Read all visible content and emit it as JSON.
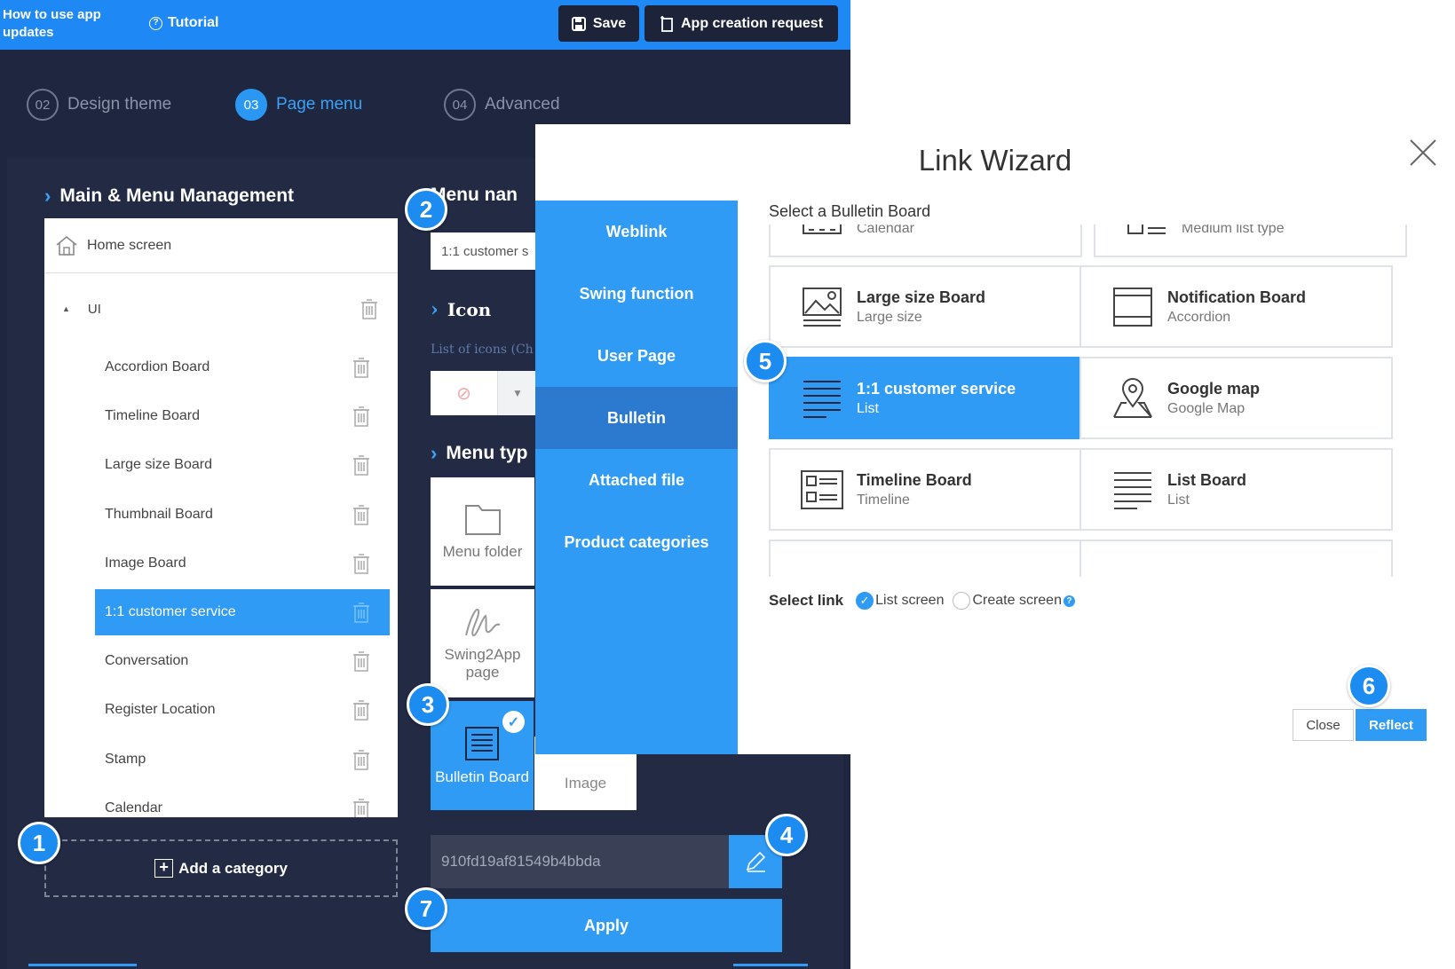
{
  "topbar": {
    "how_to": "How to use app updates",
    "tutorial": "Tutorial",
    "save": "Save",
    "app_request": "App creation request"
  },
  "steps": [
    {
      "num": "02",
      "label": "Design theme",
      "active": false
    },
    {
      "num": "03",
      "label": "Page menu",
      "active": true
    },
    {
      "num": "04",
      "label": "Advanced",
      "active": false
    }
  ],
  "main_menu": {
    "title": "Main & Menu Management",
    "home": "Home screen",
    "group": "UI",
    "items": [
      "Accordion Board",
      "Timeline Board",
      "Large size Board",
      "Thumbnail Board",
      "Image Board",
      "1:1 customer service",
      "Conversation",
      "Register Location",
      "Stamp",
      "Calendar"
    ],
    "selected_index": 5,
    "add_category": "Add a category"
  },
  "menu_name": {
    "title": "Menu nan",
    "value": "1:1 customer s"
  },
  "icon_section": {
    "title": "Icon",
    "list_label": "List of icons (Ch"
  },
  "menu_type": {
    "title": "Menu typ",
    "folder": "Menu folder",
    "swing": "Swing2App page",
    "bulletin": "Bulletin Board",
    "image": "Image"
  },
  "link_field": {
    "value": "910fd19af81549b4bbda",
    "apply": "Apply"
  },
  "wizard": {
    "title": "Link Wizard",
    "side_items": [
      "Weblink",
      "Swing function",
      "User Page",
      "Bulletin",
      "Attached file",
      "Product categories"
    ],
    "side_active_index": 3,
    "board_label": "Select a Bulletin Board",
    "partial_top": [
      "Calendar",
      "Medium list type"
    ],
    "boards": [
      {
        "title": "Large size Board",
        "sub": "Large size",
        "icon": "image-board-icon"
      },
      {
        "title": "Notification Board",
        "sub": "Accordion",
        "icon": "accordion-icon"
      },
      {
        "title": "1:1 customer service",
        "sub": "List",
        "icon": "list-icon",
        "selected": true
      },
      {
        "title": "Google map",
        "sub": "Google Map",
        "icon": "map-pin-icon"
      },
      {
        "title": "Timeline Board",
        "sub": "Timeline",
        "icon": "timeline-icon"
      },
      {
        "title": "List Board",
        "sub": "List",
        "icon": "list-icon"
      }
    ],
    "select_link_label": "Select link",
    "radio_list": "List screen",
    "radio_create": "Create screen",
    "close": "Close",
    "reflect": "Reflect"
  },
  "badges": [
    "1",
    "2",
    "3",
    "4",
    "5",
    "6",
    "7"
  ],
  "colors": {
    "primary": "#2f9bf5",
    "dark_bg": "#1f2640",
    "topbar": "#1e88f5"
  }
}
